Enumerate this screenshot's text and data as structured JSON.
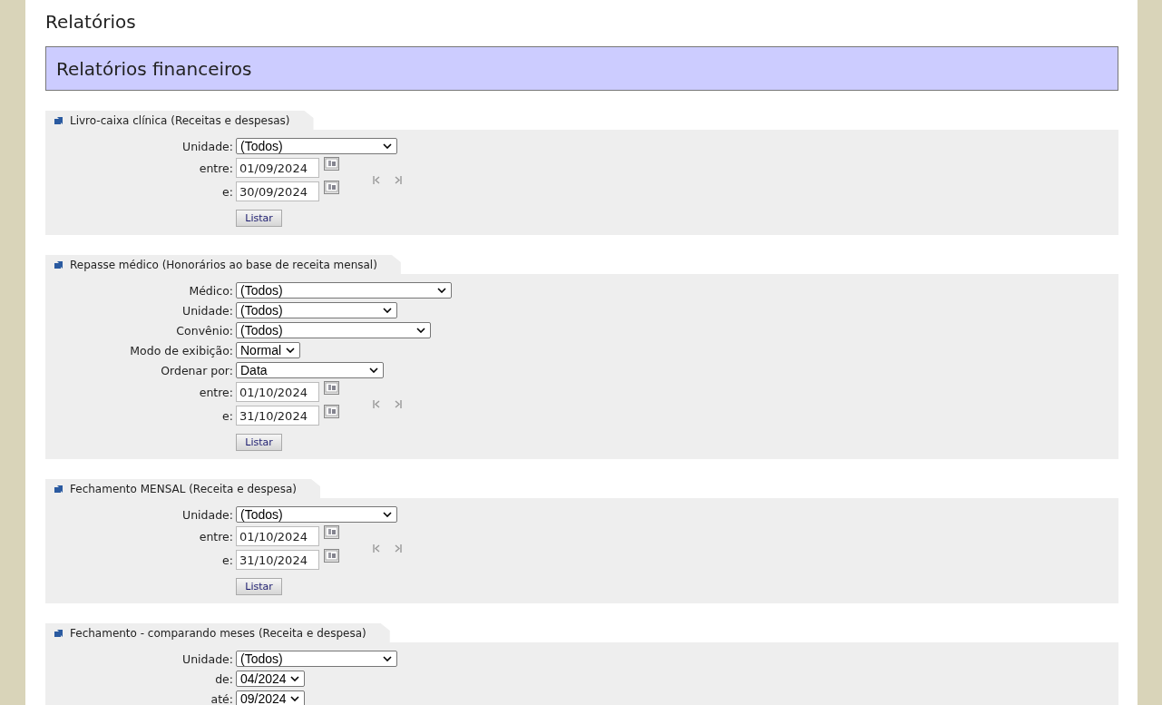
{
  "page_title": "Relatórios",
  "banner": {
    "title": "Relatórios financeiros"
  },
  "sections": [
    {
      "title": "Livro-caixa clínica (Receitas e despesas)",
      "fields": [
        {
          "kind": "select",
          "label": "Unidade:",
          "value": "(Todos)"
        },
        {
          "kind": "date",
          "label": "entre:",
          "value": "01/09/2024"
        },
        {
          "kind": "date",
          "label": "e:",
          "value": "30/09/2024"
        }
      ],
      "button": "Listar"
    },
    {
      "title": "Repasse médico (Honorários ao base de receita mensal)",
      "fields": [
        {
          "kind": "select",
          "label": "Médico:",
          "value": "(Todos)"
        },
        {
          "kind": "select",
          "label": "Unidade:",
          "value": "(Todos)"
        },
        {
          "kind": "select",
          "label": "Convênio:",
          "value": "(Todos)"
        },
        {
          "kind": "select",
          "label": "Modo de exibição:",
          "value": "Normal"
        },
        {
          "kind": "select",
          "label": "Ordenar por:",
          "value": "Data"
        },
        {
          "kind": "date",
          "label": "entre:",
          "value": "01/10/2024"
        },
        {
          "kind": "date",
          "label": "e:",
          "value": "31/10/2024"
        }
      ],
      "button": "Listar"
    },
    {
      "title": "Fechamento MENSAL (Receita e despesa)",
      "fields": [
        {
          "kind": "select",
          "label": "Unidade:",
          "value": "(Todos)"
        },
        {
          "kind": "date",
          "label": "entre:",
          "value": "01/10/2024"
        },
        {
          "kind": "date",
          "label": "e:",
          "value": "31/10/2024"
        }
      ],
      "button": "Listar"
    },
    {
      "title": "Fechamento - comparando meses (Receita e despesa)",
      "fields": [
        {
          "kind": "select",
          "label": "Unidade:",
          "value": "(Todos)"
        },
        {
          "kind": "select",
          "label": "de:",
          "value": "04/2024"
        },
        {
          "kind": "select",
          "label": "até:",
          "value": "09/2024"
        }
      ]
    }
  ]
}
